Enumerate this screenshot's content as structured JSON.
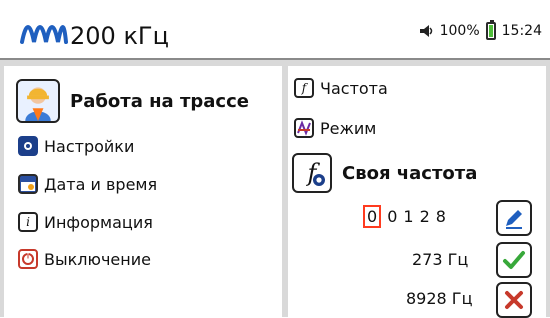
{
  "header": {
    "frequency": "200 кГц",
    "volume_percent": "100%",
    "time": "15:24"
  },
  "left_menu": {
    "title": "Работа на трассе",
    "items": [
      {
        "label": "Настройки",
        "icon": "gear-icon"
      },
      {
        "label": "Дата и время",
        "icon": "calendar-icon"
      },
      {
        "label": "Информация",
        "icon": "info-icon"
      },
      {
        "label": "Выключение",
        "icon": "power-icon"
      }
    ]
  },
  "right_panel": {
    "items": [
      {
        "label": "Частота",
        "icon": "frequency-icon"
      },
      {
        "label": "Режим",
        "icon": "mode-icon"
      }
    ],
    "section_title": "Своя частота",
    "digits": [
      "0",
      "0",
      "1",
      "2",
      "8"
    ],
    "rows": [
      {
        "value": "273 Гц",
        "action": "confirm"
      },
      {
        "value": "8928 Гц",
        "action": "cancel"
      }
    ]
  },
  "colors": {
    "accent_blue": "#1f5fbf",
    "battery_green": "#4fbe3a",
    "confirm_green": "#38a83a",
    "cancel_red": "#c7392b",
    "digit_select": "#ff3b1f"
  }
}
